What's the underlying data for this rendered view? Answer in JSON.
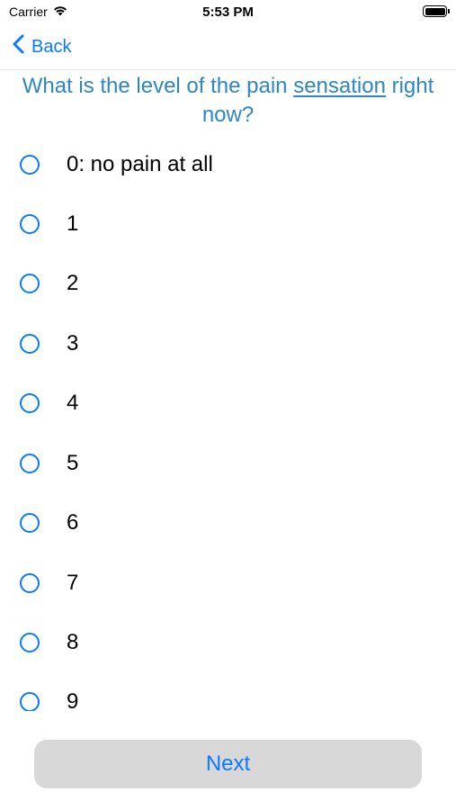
{
  "status_bar": {
    "carrier": "Carrier",
    "time": "5:53 PM",
    "icons": [
      "wifi-icon",
      "battery-icon"
    ]
  },
  "nav": {
    "back_label": "Back",
    "back_icon": "chevron-left-icon"
  },
  "question": {
    "prefix": "What is the level of the pain ",
    "underlined": "sensation",
    "suffix": " right now?"
  },
  "options": [
    {
      "label": "0: no pain at all"
    },
    {
      "label": "1"
    },
    {
      "label": "2"
    },
    {
      "label": "3"
    },
    {
      "label": "4"
    },
    {
      "label": "5"
    },
    {
      "label": "6"
    },
    {
      "label": "7"
    },
    {
      "label": "8"
    },
    {
      "label": "9"
    }
  ],
  "next_label": "Next",
  "colors": {
    "accent": "#0a7aff",
    "question": "#2f86c5",
    "next_background": "#d8d8d8"
  }
}
